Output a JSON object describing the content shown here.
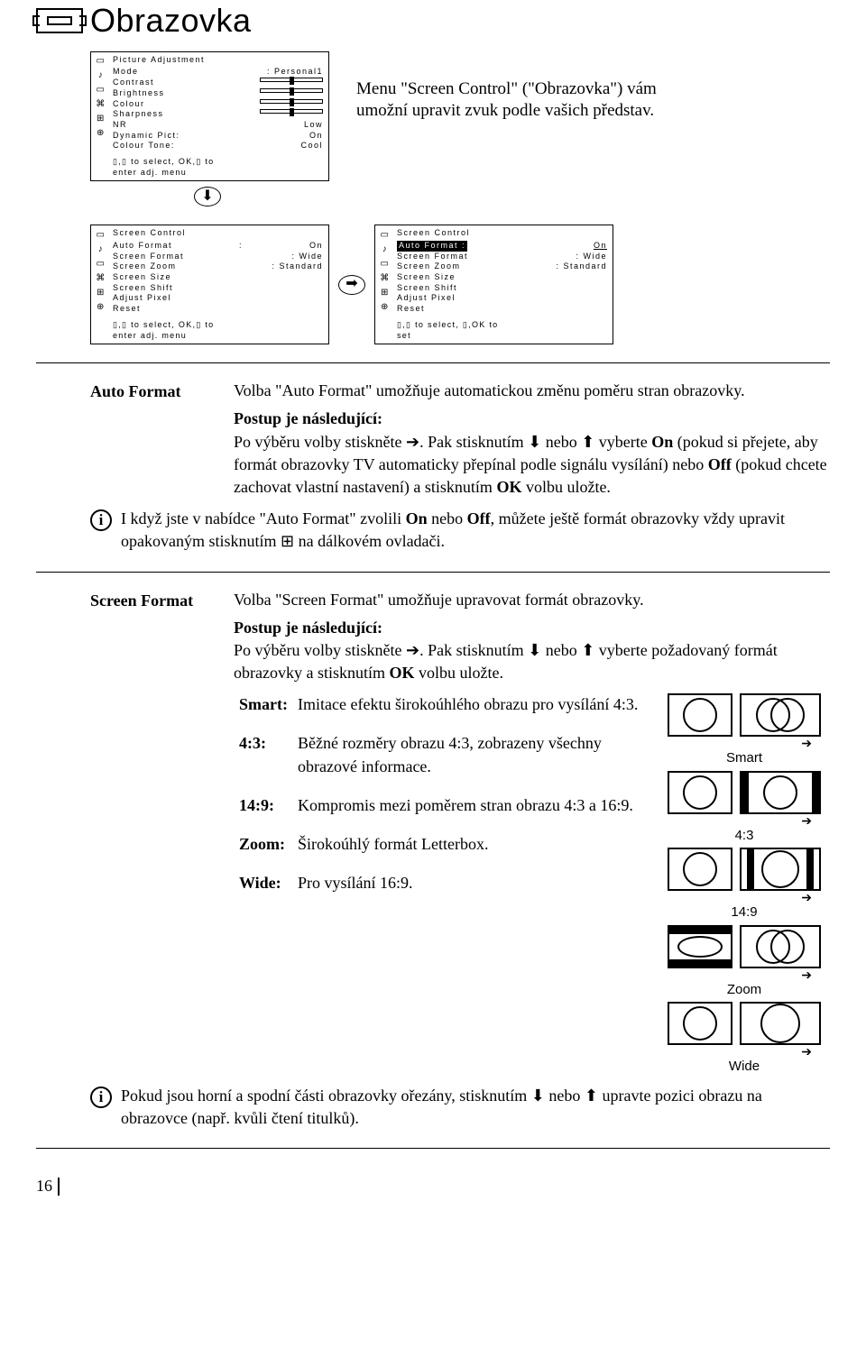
{
  "page_title": "Obrazovka",
  "intro": "Menu \"Screen Control\" (\"Obrazovka\") vám umožní upravit zvuk podle vašich představ.",
  "osd1": {
    "title": "Picture Adjustment",
    "mode_lbl": "Mode",
    "mode_val": ": Personal1",
    "contrast_lbl": "Contrast",
    "brightness_lbl": "Brightness",
    "colour_lbl": "Colour",
    "sharpness_lbl": "Sharpness",
    "nr_lbl": "NR",
    "nr_val": "Low",
    "dynpic_lbl": "Dynamic Pict:",
    "dynpic_val": "On",
    "ctone_lbl": "Colour Tone:",
    "ctone_val": "Cool",
    "hint": "▯,▯ to select, OK,▯ to\nenter adj. menu"
  },
  "osd2": {
    "title": "Screen Control",
    "af_lbl": "Auto Format",
    "af_sep": ":",
    "af_val": "On",
    "sf_lbl": "Screen Format",
    "sf_val": ": Wide",
    "sz_lbl": "Screen Zoom",
    "sz_val": ": Standard",
    "ss_lbl": "Screen Size",
    "sh_lbl": "Screen Shift",
    "ap_lbl": "Adjust Pixel",
    "rs_lbl": "Reset",
    "hint": "▯,▯ to select, OK,▯ to\nenter adj. menu"
  },
  "osd3": {
    "title": "Screen Control",
    "af_lbl": "Auto Format :",
    "af_val": "On",
    "sf_lbl": "Screen Format",
    "sf_val": ": Wide",
    "sz_lbl": "Screen Zoom",
    "sz_val": ": Standard",
    "ss_lbl": "Screen Size",
    "sh_lbl": "Screen Shift",
    "ap_lbl": "Adjust Pixel",
    "rs_lbl": "Reset",
    "hint": "▯,▯ to select, ▯,OK to\nset"
  },
  "auto_format": {
    "label": "Auto Format",
    "p1": "Volba \"Auto Format\" umožňuje automatickou změnu poměru stran obrazovky.",
    "proc_head": "Postup je následující:",
    "p2a": "Po výběru volby stiskněte ",
    "p2b": ". Pak stisknutím ",
    "p2c": " nebo ",
    "p2d": " vyberte ",
    "on": "On",
    "p2e": " (pokud si přejete, aby formát obrazovky TV automaticky přepínal podle signálu vysílání) nebo ",
    "off": "Off",
    "p2f": " (pokud chcete zachovat vlastní nastavení) a stisknutím ",
    "ok": "OK",
    "p2g": " volbu uložte."
  },
  "note1a": "I když jste v nabídce \"Auto Format\" zvolili ",
  "note1b": " nebo ",
  "note1c": ", můžete ještě formát obrazovky vždy upravit opakovaným stisknutím ",
  "note1d": " na dálkovém ovladači.",
  "screen_format": {
    "label": "Screen Format",
    "p1": "Volba \"Screen Format\" umožňuje upravovat formát obrazovky.",
    "proc_head": "Postup je následující:",
    "p2a": "Po výběru volby stiskněte ",
    "p2b": ". Pak stisknutím ",
    "p2c": " nebo ",
    "p2d": " vyberte požadovaný formát obrazovky a stisknutím ",
    "ok": "OK",
    "p2e": " volbu uložte."
  },
  "formats": {
    "smart_l": "Smart:",
    "smart_d": "Imitace efektu širokoúhlého obrazu pro vysílání 4:3.",
    "r43_l": "4:3:",
    "r43_d": "Běžné rozměry obrazu 4:3, zobrazeny všechny obrazové informace.",
    "r149_l": "14:9:",
    "r149_d": "Kompromis mezi poměrem stran obrazu 4:3 a 16:9.",
    "zoom_l": "Zoom:",
    "zoom_d": "Širokoúhlý formát Letterbox.",
    "wide_l": "Wide:",
    "wide_d": "Pro vysílání 16:9."
  },
  "fmt_caps": {
    "smart": "Smart",
    "r43": "4:3",
    "r149": "14:9",
    "zoom": "Zoom",
    "wide": "Wide"
  },
  "note2a": "Pokud jsou horní a spodní části obrazovky ořezány, stisknutím ",
  "note2b": " nebo ",
  "note2c": " upravte pozici obrazu na obrazovce (např. kvůli čtení titulků).",
  "page_number": "16"
}
